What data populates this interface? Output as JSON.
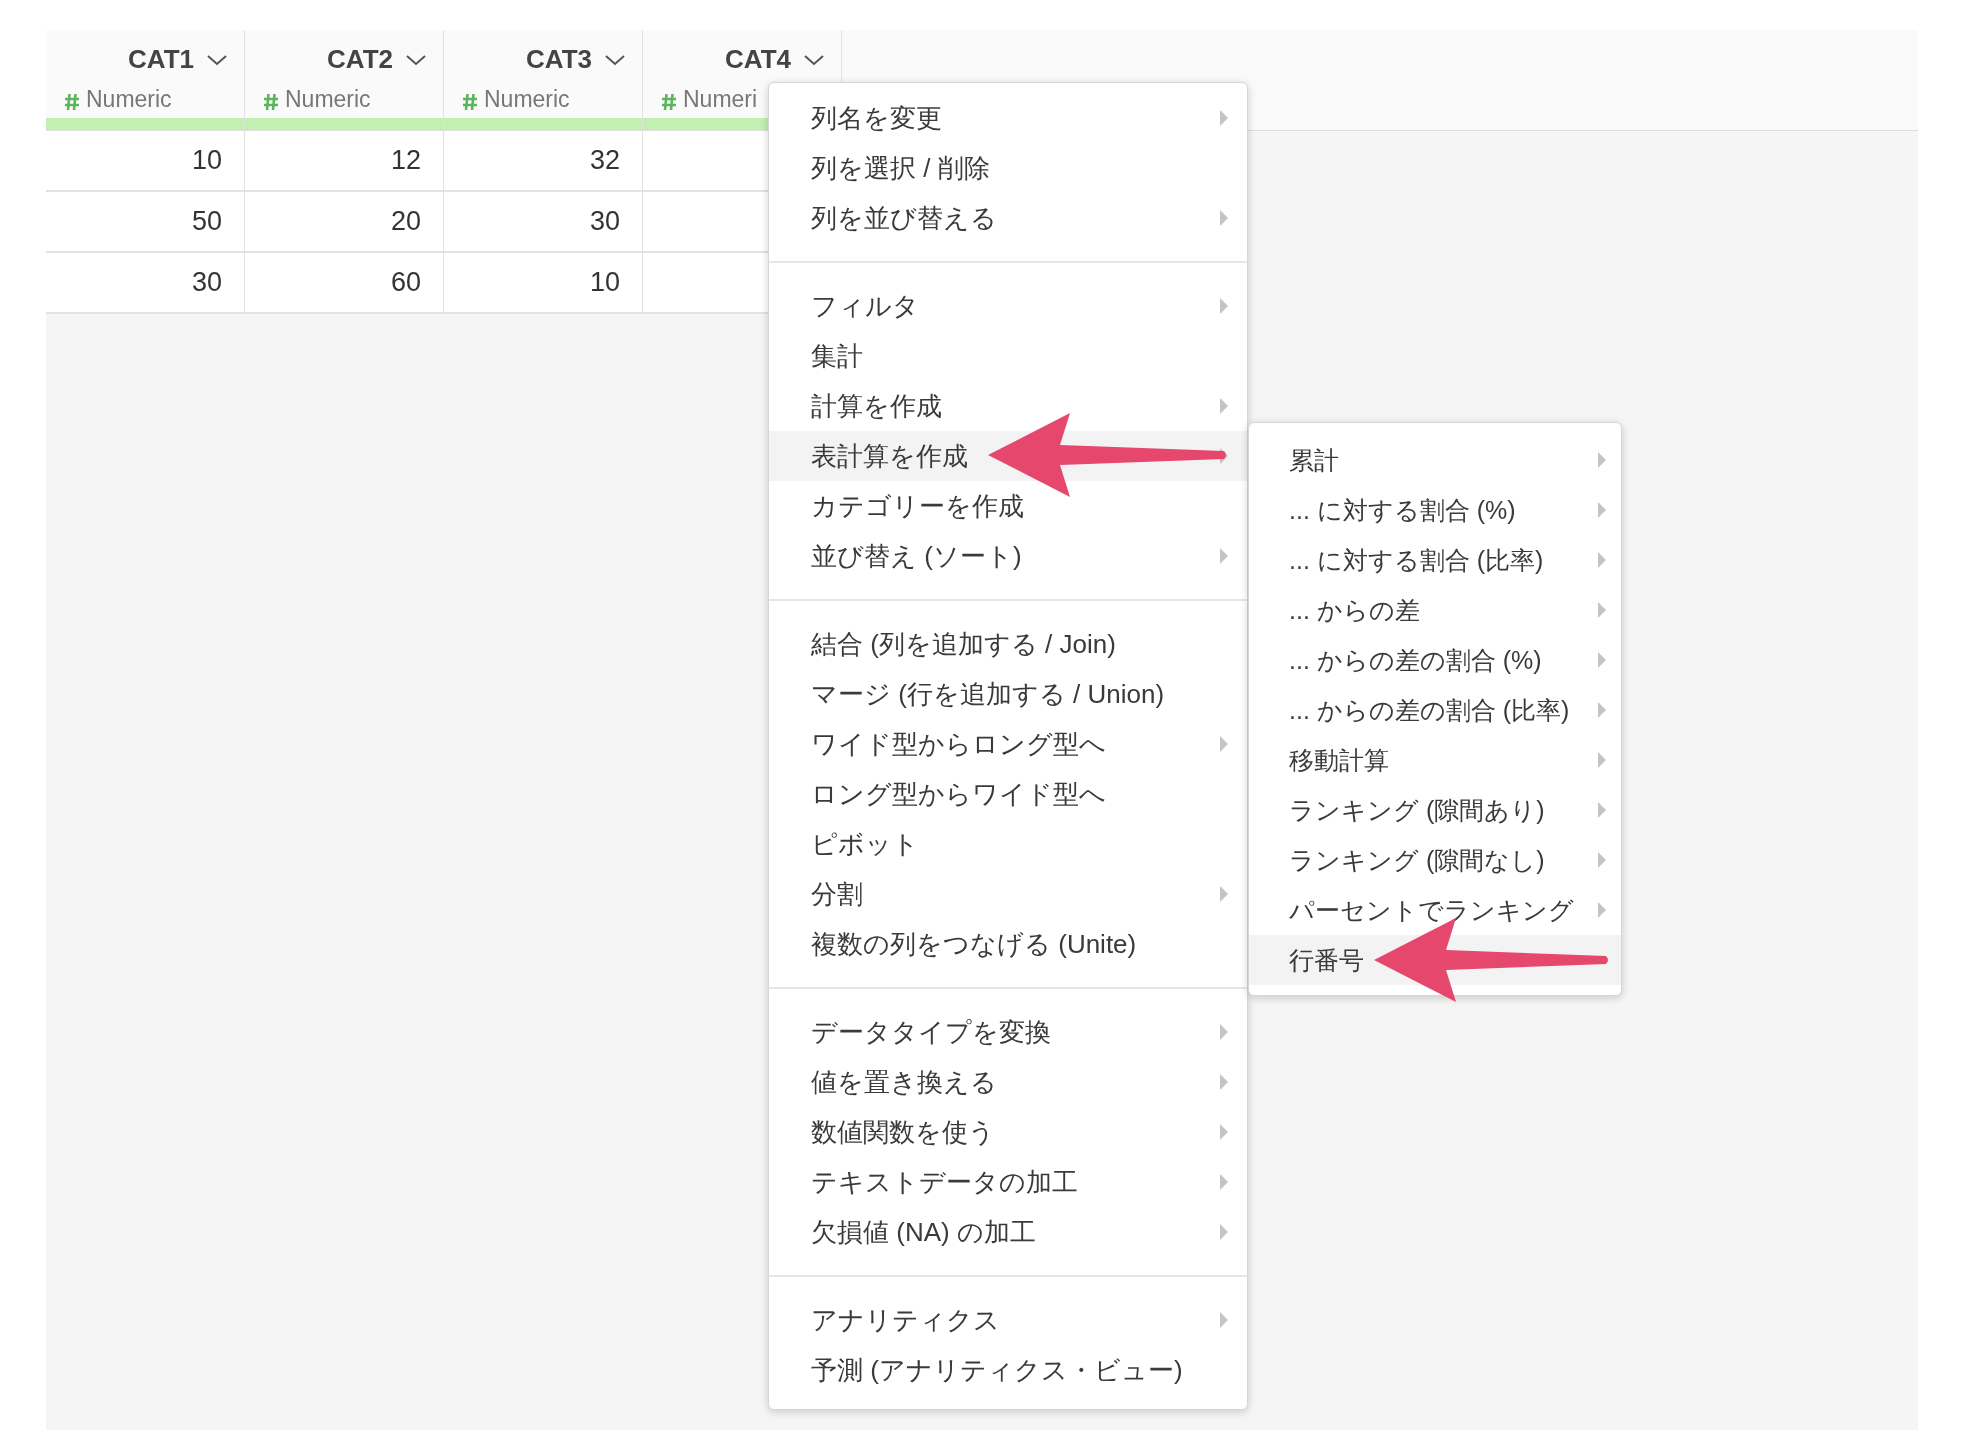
{
  "table": {
    "columns": [
      {
        "name": "CAT1",
        "type": "Numeric"
      },
      {
        "name": "CAT2",
        "type": "Numeric"
      },
      {
        "name": "CAT3",
        "type": "Numeric"
      },
      {
        "name": "CAT4",
        "type": "Numeri"
      }
    ],
    "rows": [
      [
        "10",
        "12",
        "32"
      ],
      [
        "50",
        "20",
        "30"
      ],
      [
        "30",
        "60",
        "10"
      ]
    ]
  },
  "menu": {
    "groups": [
      [
        {
          "label": "列名を変更",
          "submenu": true,
          "selected": false
        },
        {
          "label": "列を選択 / 削除",
          "submenu": false,
          "selected": false
        },
        {
          "label": "列を並び替える",
          "submenu": true,
          "selected": false
        }
      ],
      [
        {
          "label": "フィルタ",
          "submenu": true,
          "selected": false
        },
        {
          "label": "集計",
          "submenu": false,
          "selected": false
        },
        {
          "label": "計算を作成",
          "submenu": true,
          "selected": false
        },
        {
          "label": "表計算を作成",
          "submenu": true,
          "selected": true
        },
        {
          "label": "カテゴリーを作成",
          "submenu": false,
          "selected": false
        },
        {
          "label": "並び替え (ソート)",
          "submenu": true,
          "selected": false
        }
      ],
      [
        {
          "label": "結合 (列を追加する / Join)",
          "submenu": false,
          "selected": false
        },
        {
          "label": "マージ (行を追加する / Union)",
          "submenu": false,
          "selected": false
        },
        {
          "label": "ワイド型からロング型へ",
          "submenu": true,
          "selected": false
        },
        {
          "label": "ロング型からワイド型へ",
          "submenu": false,
          "selected": false
        },
        {
          "label": "ピボット",
          "submenu": false,
          "selected": false
        },
        {
          "label": "分割",
          "submenu": true,
          "selected": false
        },
        {
          "label": "複数の列をつなげる (Unite)",
          "submenu": false,
          "selected": false
        }
      ],
      [
        {
          "label": "データタイプを変換",
          "submenu": true,
          "selected": false
        },
        {
          "label": "値を置き換える",
          "submenu": true,
          "selected": false
        },
        {
          "label": "数値関数を使う",
          "submenu": true,
          "selected": false
        },
        {
          "label": "テキストデータの加工",
          "submenu": true,
          "selected": false
        },
        {
          "label": "欠損値 (NA) の加工",
          "submenu": true,
          "selected": false
        }
      ],
      [
        {
          "label": "アナリティクス",
          "submenu": true,
          "selected": false
        },
        {
          "label": "予測 (アナリティクス・ビュー)",
          "submenu": false,
          "selected": false
        }
      ]
    ]
  },
  "submenu": {
    "items": [
      {
        "label": "累計",
        "submenu": true,
        "selected": false
      },
      {
        "label": "... に対する割合 (%)",
        "submenu": true,
        "selected": false
      },
      {
        "label": "... に対する割合 (比率)",
        "submenu": true,
        "selected": false
      },
      {
        "label": "... からの差",
        "submenu": true,
        "selected": false
      },
      {
        "label": "... からの差の割合 (%)",
        "submenu": true,
        "selected": false
      },
      {
        "label": "... からの差の割合 (比率)",
        "submenu": true,
        "selected": false
      },
      {
        "label": "移動計算",
        "submenu": true,
        "selected": false
      },
      {
        "label": "ランキング (隙間あり)",
        "submenu": true,
        "selected": false
      },
      {
        "label": "ランキング (隙間なし)",
        "submenu": true,
        "selected": false
      },
      {
        "label": "パーセントでランキング",
        "submenu": true,
        "selected": false
      },
      {
        "label": "行番号",
        "submenu": false,
        "selected": true
      }
    ]
  }
}
